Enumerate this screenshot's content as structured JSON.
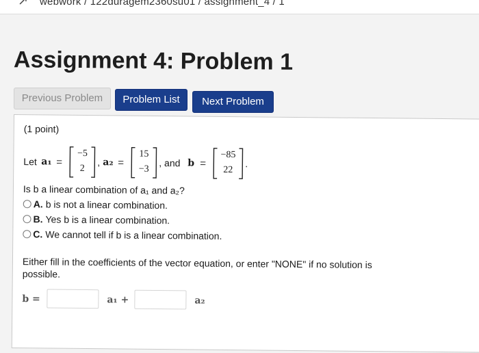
{
  "breadcrumb": {
    "text": "webwork / 122duragem2360su01 / assignment_4 / 1"
  },
  "page_title": "Assignment 4: Problem 1",
  "nav": {
    "previous": "Previous Problem",
    "list": "Problem List",
    "next": "Next Problem"
  },
  "problem": {
    "points": "(1 point)",
    "let": "Let",
    "a1_label": "a₁",
    "a2_label": "a₂",
    "b_label": "b",
    "equals": "=",
    "comma": ",",
    "and": ", and",
    "period": ".",
    "a1": [
      "−5",
      "2"
    ],
    "a2": [
      "15",
      "−3"
    ],
    "b": [
      "−85",
      "22"
    ],
    "question": "Is b a linear combination of a₁ and a₂?",
    "options": [
      {
        "letter": "A.",
        "text": "b is not a linear combination."
      },
      {
        "letter": "B.",
        "text": "Yes b is a linear combination."
      },
      {
        "letter": "C.",
        "text": "We cannot tell if b is a linear combination."
      }
    ],
    "instructions": "Either fill in the coefficients of the vector equation, or enter \"NONE\" if no solution is possible.",
    "eq_b": "b =",
    "eq_a1": "a₁ +",
    "eq_a2": "a₂"
  }
}
